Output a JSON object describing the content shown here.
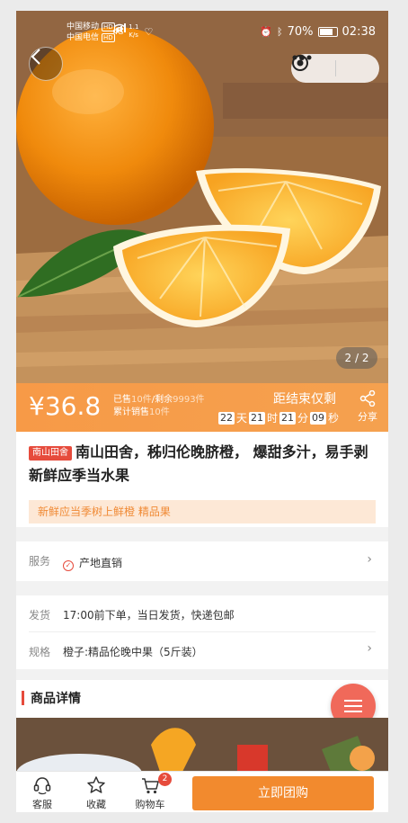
{
  "status_bar": {
    "carrier1": "中国移动",
    "carrier2": "中国电信",
    "hd": "HD",
    "net": "4G",
    "speed": "1.1\nK/s",
    "battery": "70%",
    "time": "02:38"
  },
  "gallery": {
    "pager": "2 / 2"
  },
  "price_bar": {
    "price": "¥36.8",
    "sold_prefix": "已售",
    "sold_count": "10件",
    "remain_prefix": "/剩余",
    "remain_count": "9993件",
    "total_prefix": "累计销售",
    "total_count": "10件",
    "countdown_label": "距结束仅剩",
    "days": "22",
    "day_unit": "天",
    "hours": "21",
    "hour_unit": "时",
    "minutes": "21",
    "minute_unit": "分",
    "seconds": "09",
    "second_unit": "秒",
    "share_label": "分享"
  },
  "product": {
    "shop_tag": "南山田舍",
    "title": "南山田舍，秭归伦晚脐橙，  爆甜多汁，易手剥新鲜应季当水果",
    "promo": "新鲜应当季树上鲜橙 精品果"
  },
  "service_row": {
    "label": "服务",
    "value": "产地直销"
  },
  "shipping_row": {
    "label": "发货",
    "value": "17:00前下单，当日发货，快递包邮"
  },
  "spec_row": {
    "label": "规格",
    "value": "橙子:精品伦晚中果（5斤装）"
  },
  "details": {
    "heading": "商品详情"
  },
  "tabbar": {
    "service_label": "客服",
    "favorite_label": "收藏",
    "cart_label": "购物车",
    "cart_badge": "2",
    "buy_label": "立即团购"
  },
  "colors": {
    "accent": "#f28a2e",
    "tag": "#e64b3c",
    "price_bar": "#f79a47"
  }
}
